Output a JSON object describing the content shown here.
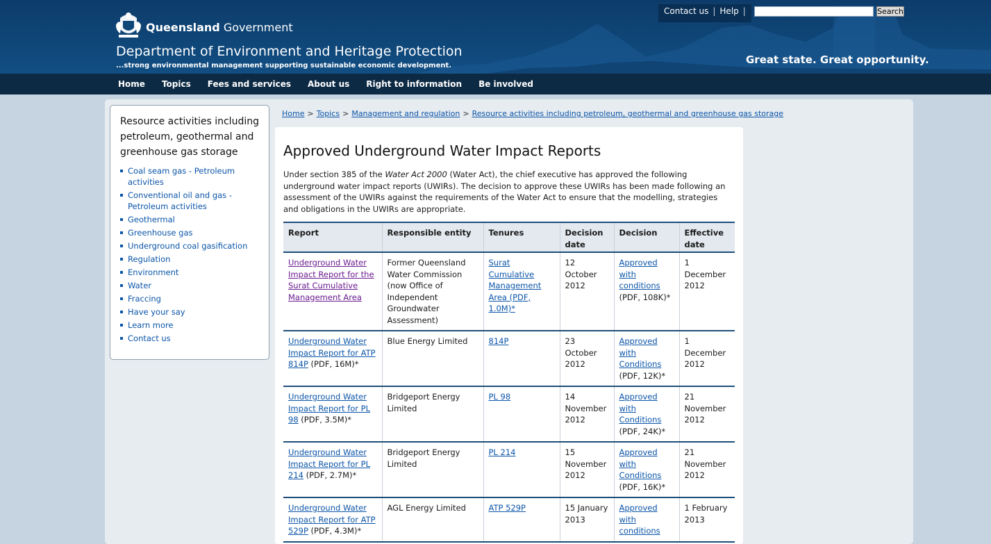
{
  "header": {
    "brand_bold": "Queensland",
    "brand_rest": " Government",
    "department": "Department of Environment and Heritage Protection",
    "tagline": "...strong environmental management supporting sustainable economic development.",
    "slogan": "Great state. Great opportunity.",
    "contact_label": "Contact us",
    "help_label": "Help",
    "search_value": "",
    "search_button": "Search"
  },
  "nav": [
    "Home",
    "Topics",
    "Fees and services",
    "About us",
    "Right to information",
    "Be involved"
  ],
  "breadcrumb": [
    "Home",
    "Topics",
    "Management and regulation",
    "Resource activities including petroleum, geothermal and greenhouse gas storage"
  ],
  "sidebar": {
    "title": "Resource activities including petroleum, geothermal and greenhouse gas storage",
    "items": [
      "Coal seam gas - Petroleum activities",
      "Conventional oil and gas - Petroleum activities",
      "Geothermal",
      "Greenhouse gas",
      "Underground coal gasification",
      "Regulation",
      "Environment",
      "Water",
      "Fraccing",
      "Have your say",
      "Learn more",
      "Contact us"
    ]
  },
  "main": {
    "title": "Approved Underground Water Impact Reports",
    "intro_before": "Under section 385 of the ",
    "intro_act": "Water Act 2000",
    "intro_after": " (Water Act), the chief executive has approved the following underground water impact reports (UWIRs). The decision to approve these UWIRs has been made following an assessment of the UWIRs against the requirements of the Water Act to ensure that the modelling, strategies and obligations in the UWIRs are appropriate."
  },
  "table": {
    "headers": [
      "Report",
      "Responsible entity",
      "Tenures",
      "Decision date",
      "Decision",
      "Effective date"
    ],
    "rows": [
      {
        "report_link": "Underground Water Impact Report for the Surat Cumulative Management Area",
        "report_suffix": "",
        "entity": "Former Queensland Water Commission (now Office of Independent Groundwater Assessment)",
        "tenure_link": "Surat Cumulative Management Area",
        "tenure_suffix": " (PDF, 1.0M)*",
        "decision_date": "12 October 2012",
        "decision_link": "Approved with conditions",
        "decision_suffix": " (PDF, 108K)*",
        "effective_date": "1 December 2012"
      },
      {
        "report_link": "Underground Water Impact Report for ATP 814P",
        "report_suffix": " (PDF, 16M)*",
        "entity": "Blue Energy Limited",
        "tenure_link": "814P",
        "tenure_suffix": "",
        "decision_date": "23 October 2012",
        "decision_link": "Approved with Conditions",
        "decision_suffix": " (PDF, 12K)*",
        "effective_date": "1 December 2012"
      },
      {
        "report_link": "Underground Water Impact Report for PL 98",
        "report_suffix": " (PDF, 3.5M)*",
        "entity": "Bridgeport Energy Limited",
        "tenure_link": "PL 98",
        "tenure_suffix": "",
        "decision_date": "14 November 2012",
        "decision_link": "Approved with Conditions",
        "decision_suffix": " (PDF, 24K)*",
        "effective_date": "21 November 2012"
      },
      {
        "report_link": "Underground Water Impact Report for PL 214",
        "report_suffix": " (PDF, 2.7M)*",
        "entity": "Bridgeport Energy Limited",
        "tenure_link": "PL 214",
        "tenure_suffix": "",
        "decision_date": "15 November 2012",
        "decision_link": "Approved with Conditions",
        "decision_suffix": " (PDF, 16K)*",
        "effective_date": "21 November 2012"
      },
      {
        "report_link": "Underground Water Impact Report for ATP 529P",
        "report_suffix": " (PDF, 4.3M)*",
        "entity": "AGL Energy Limited",
        "tenure_link": "ATP 529P",
        "tenure_suffix": "",
        "decision_date": "15 January 2013",
        "decision_link": "Approved with conditions",
        "decision_suffix": "",
        "effective_date": "1 February 2013"
      }
    ]
  },
  "colors": {
    "header_bg": "#0f4779",
    "nav_bg": "#0c2a44",
    "link": "#0b55a8",
    "visited_link": "#6a1b8f",
    "table_rule": "#1c4d7a",
    "page_bg": "#c6d4e1"
  }
}
